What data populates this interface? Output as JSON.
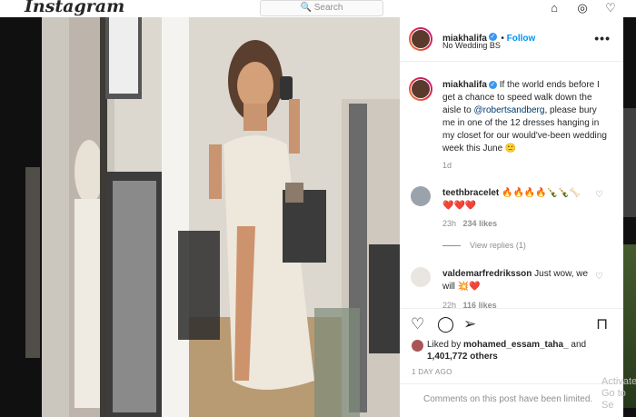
{
  "app": {
    "logo": "Instagram",
    "search_placeholder": "Search"
  },
  "post": {
    "username": "miakhalifa",
    "follow_label": "Follow",
    "location": "No Wedding BS",
    "caption_prefix": "If the world ends before I get a chance to speed walk down the aisle to ",
    "caption_mention": "@robertsandberg",
    "caption_suffix": ", please bury me in one of the 12 dresses hanging in my closet for our would've-been wedding week this June 🙁",
    "caption_age": "1d",
    "comments": [
      {
        "username": "teethbracelet",
        "text": "🔥🔥🔥🔥🍾🍾🦴",
        "text2": "❤️❤️❤️",
        "age": "23h",
        "likes": "234 likes"
      },
      {
        "username": "valdemarfredriksson",
        "text": "Just wow, we will 💥❤️",
        "age": "22h",
        "likes": "116 likes"
      }
    ],
    "view_replies": "View replies (1)",
    "liked_by_prefix": "Liked by ",
    "liked_by_user": "mohamed_essam_taha_",
    "liked_by_and": " and",
    "liked_by_others": "1,401,772 others",
    "date": "1 DAY AGO",
    "comments_limited": "Comments on this post have been limited."
  },
  "watermark": {
    "line1": "Activate",
    "line2": "Go to Se"
  },
  "colors": {
    "follow": "#0095f6",
    "verified": "#3897f0"
  }
}
